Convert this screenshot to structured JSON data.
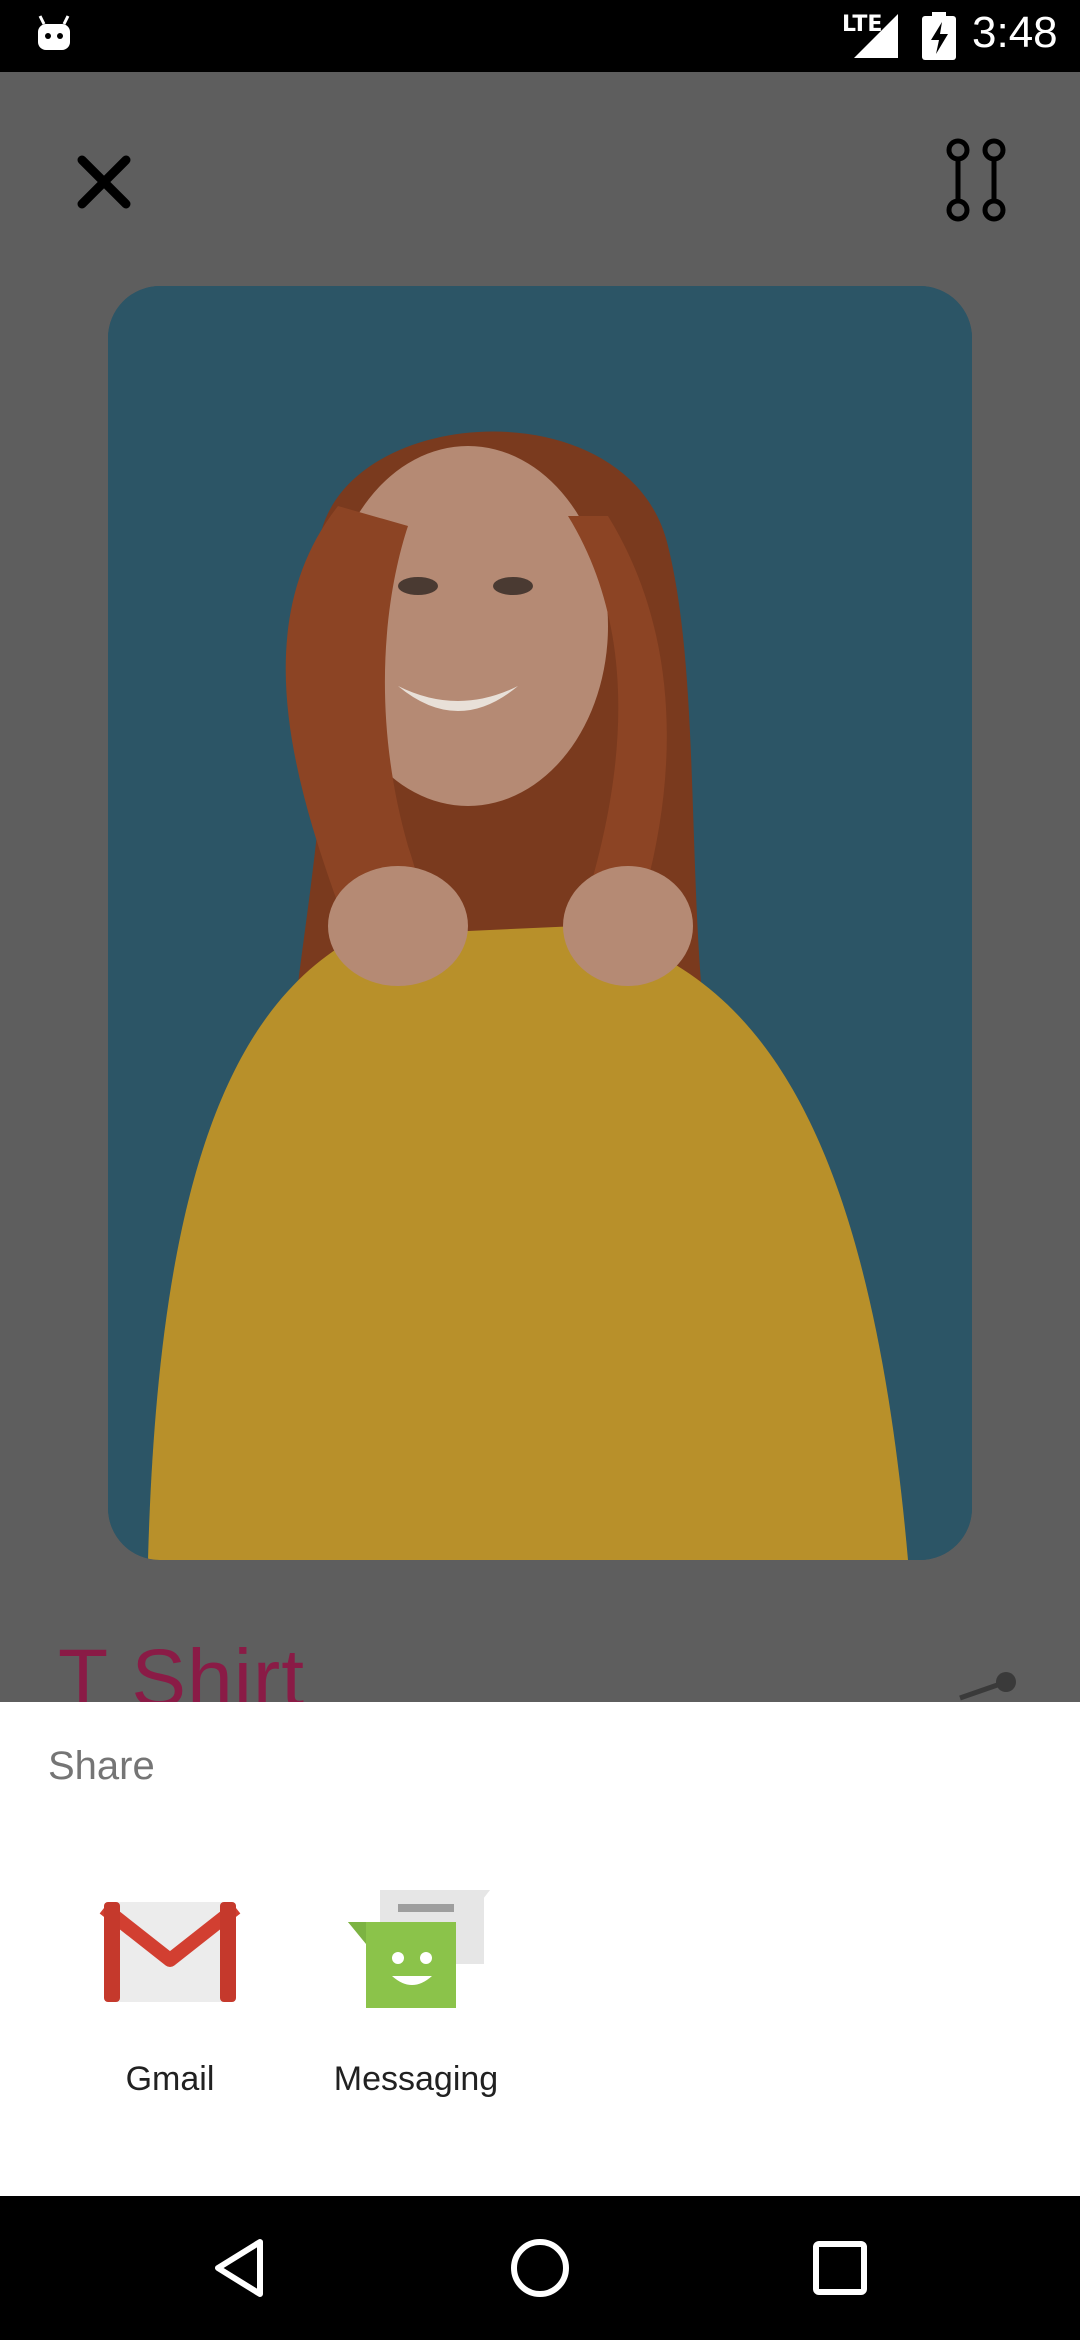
{
  "status_bar": {
    "time": "3:48",
    "network": "LTE",
    "icons": [
      "android-icon",
      "signal-icon",
      "battery-charging-icon"
    ]
  },
  "app": {
    "close_icon": "close-icon",
    "compare_icon": "compare-icon",
    "product_title": "T Shirt"
  },
  "share_sheet": {
    "title": "Share",
    "targets": [
      {
        "label": "Gmail",
        "icon": "gmail-icon"
      },
      {
        "label": "Messaging",
        "icon": "messaging-icon"
      }
    ]
  },
  "nav_bar": {
    "buttons": [
      "back-icon",
      "home-icon",
      "recents-icon"
    ]
  },
  "colors": {
    "scrim": "#5e5e5e",
    "title_accent": "#8a1b46",
    "photo_background": "#2c5566"
  }
}
